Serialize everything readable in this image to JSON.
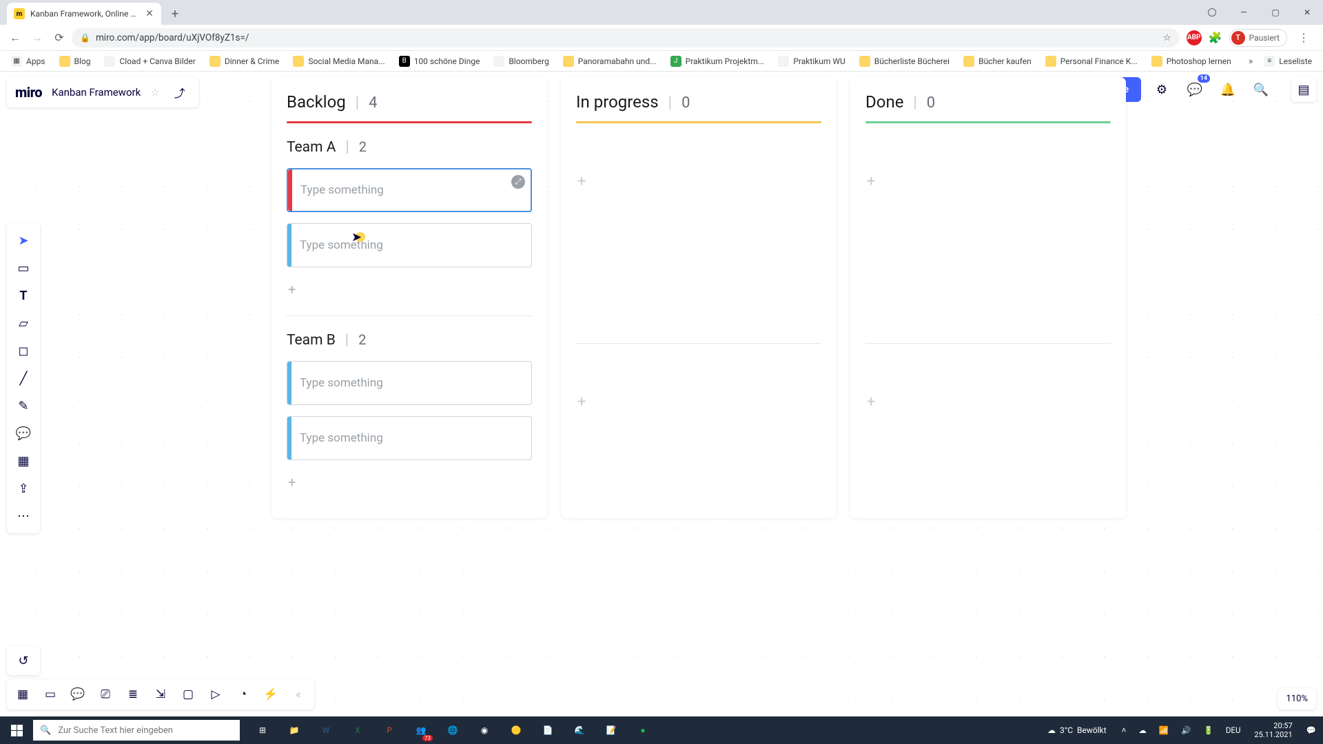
{
  "browser": {
    "tab_title": "Kanban Framework, Online Whit...",
    "url": "miro.com/app/board/uXjVOf8yZ1s=/",
    "profile_status": "Pausiert",
    "profile_initial": "T",
    "apps_label": "Apps",
    "reading_list_label": "Leseliste",
    "bookmarks": [
      {
        "label": "Blog"
      },
      {
        "label": "Cload + Canva Bilder"
      },
      {
        "label": "Dinner & Crime"
      },
      {
        "label": "Social Media Mana..."
      },
      {
        "label": "100 schöne Dinge"
      },
      {
        "label": "Bloomberg"
      },
      {
        "label": "Panoramabahn und..."
      },
      {
        "label": "Praktikum Projektm..."
      },
      {
        "label": "Praktikum WU"
      },
      {
        "label": "Bücherliste Bücherei"
      },
      {
        "label": "Bücher kaufen"
      },
      {
        "label": "Personal Finance K..."
      },
      {
        "label": "Photoshop lernen"
      }
    ]
  },
  "miro": {
    "logo": "miro",
    "board_name": "Kanban Framework",
    "share_label": "Share",
    "notif_count": "14",
    "zoom": "110%"
  },
  "kanban": {
    "card_placeholder": "Type something",
    "columns": [
      {
        "title": "Backlog",
        "count": "4",
        "rule": "red"
      },
      {
        "title": "In progress",
        "count": "0",
        "rule": "yellow"
      },
      {
        "title": "Done",
        "count": "0",
        "rule": "green"
      }
    ],
    "groups": [
      {
        "title": "Team A",
        "count": "2"
      },
      {
        "title": "Team B",
        "count": "2"
      }
    ]
  },
  "taskbar": {
    "search_placeholder": "Zur Suche Text hier eingeben",
    "weather_temp": "3°C",
    "weather_desc": "Bewölkt",
    "lang": "DEU",
    "time": "20:57",
    "date": "25.11.2021",
    "teams_badge": "73"
  }
}
